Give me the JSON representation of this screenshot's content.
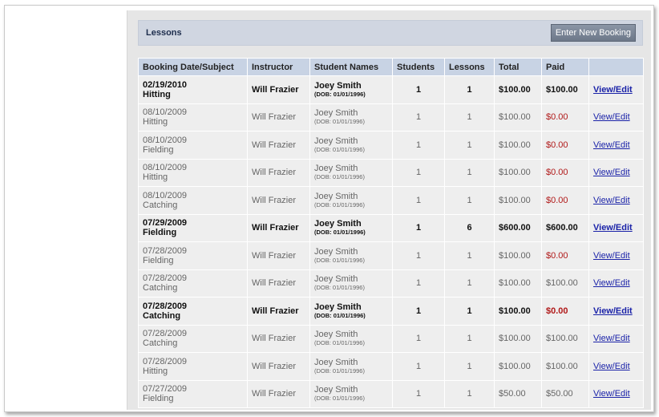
{
  "header": {
    "title": "Lessons",
    "new_booking_label": "Enter New Booking"
  },
  "table": {
    "columns": [
      "Booking Date/Subject",
      "Instructor",
      "Student Names",
      "Students",
      "Lessons",
      "Total",
      "Paid",
      ""
    ],
    "rows": [
      {
        "date": "02/19/2010",
        "subject": "Hitting",
        "instructor": "Will Frazier",
        "student": "Joey Smith",
        "dob": "(DOB: 01/01/1996)",
        "students": "1",
        "lessons": "1",
        "total": "$100.00",
        "paid": "$100.00",
        "action": "View/Edit",
        "bold": true
      },
      {
        "date": "08/10/2009",
        "subject": "Hitting",
        "instructor": "Will Frazier",
        "student": "Joey Smith",
        "dob": "(DOB: 01/01/1996)",
        "students": "1",
        "lessons": "1",
        "total": "$100.00",
        "paid": "$0.00",
        "action": "View/Edit",
        "bold": false
      },
      {
        "date": "08/10/2009",
        "subject": "Fielding",
        "instructor": "Will Frazier",
        "student": "Joey Smith",
        "dob": "(DOB: 01/01/1996)",
        "students": "1",
        "lessons": "1",
        "total": "$100.00",
        "paid": "$0.00",
        "action": "View/Edit",
        "bold": false
      },
      {
        "date": "08/10/2009",
        "subject": "Hitting",
        "instructor": "Will Frazier",
        "student": "Joey Smith",
        "dob": "(DOB: 01/01/1996)",
        "students": "1",
        "lessons": "1",
        "total": "$100.00",
        "paid": "$0.00",
        "action": "View/Edit",
        "bold": false
      },
      {
        "date": "08/10/2009",
        "subject": "Catching",
        "instructor": "Will Frazier",
        "student": "Joey Smith",
        "dob": "(DOB: 01/01/1996)",
        "students": "1",
        "lessons": "1",
        "total": "$100.00",
        "paid": "$0.00",
        "action": "View/Edit",
        "bold": false
      },
      {
        "date": "07/29/2009",
        "subject": "Fielding",
        "instructor": "Will Frazier",
        "student": "Joey Smith",
        "dob": "(DOB: 01/01/1996)",
        "students": "1",
        "lessons": "6",
        "total": "$600.00",
        "paid": "$600.00",
        "action": "View/Edit",
        "bold": true
      },
      {
        "date": "07/28/2009",
        "subject": "Fielding",
        "instructor": "Will Frazier",
        "student": "Joey Smith",
        "dob": "(DOB: 01/01/1996)",
        "students": "1",
        "lessons": "1",
        "total": "$100.00",
        "paid": "$0.00",
        "action": "View/Edit",
        "bold": false
      },
      {
        "date": "07/28/2009",
        "subject": "Catching",
        "instructor": "Will Frazier",
        "student": "Joey Smith",
        "dob": "(DOB: 01/01/1996)",
        "students": "1",
        "lessons": "1",
        "total": "$100.00",
        "paid": "$100.00",
        "action": "View/Edit",
        "bold": false
      },
      {
        "date": "07/28/2009",
        "subject": "Catching",
        "instructor": "Will Frazier",
        "student": "Joey Smith",
        "dob": "(DOB: 01/01/1996)",
        "students": "1",
        "lessons": "1",
        "total": "$100.00",
        "paid": "$0.00",
        "action": "View/Edit",
        "bold": true
      },
      {
        "date": "07/28/2009",
        "subject": "Catching",
        "instructor": "Will Frazier",
        "student": "Joey Smith",
        "dob": "(DOB: 01/01/1996)",
        "students": "1",
        "lessons": "1",
        "total": "$100.00",
        "paid": "$100.00",
        "action": "View/Edit",
        "bold": false
      },
      {
        "date": "07/28/2009",
        "subject": "Hitting",
        "instructor": "Will Frazier",
        "student": "Joey Smith",
        "dob": "(DOB: 01/01/1996)",
        "students": "1",
        "lessons": "1",
        "total": "$100.00",
        "paid": "$100.00",
        "action": "View/Edit",
        "bold": false
      },
      {
        "date": "07/27/2009",
        "subject": "Fielding",
        "instructor": "Will Frazier",
        "student": "Joey Smith",
        "dob": "(DOB: 01/01/1996)",
        "students": "1",
        "lessons": "1",
        "total": "$50.00",
        "paid": "$50.00",
        "action": "View/Edit",
        "bold": false
      }
    ]
  },
  "colors": {
    "header_bg": "#d0d6e1",
    "column_header_bg": "#c8d3e4",
    "row_bg": "#eeeeee",
    "unpaid": "#b01818",
    "link": "#1a22a8"
  }
}
